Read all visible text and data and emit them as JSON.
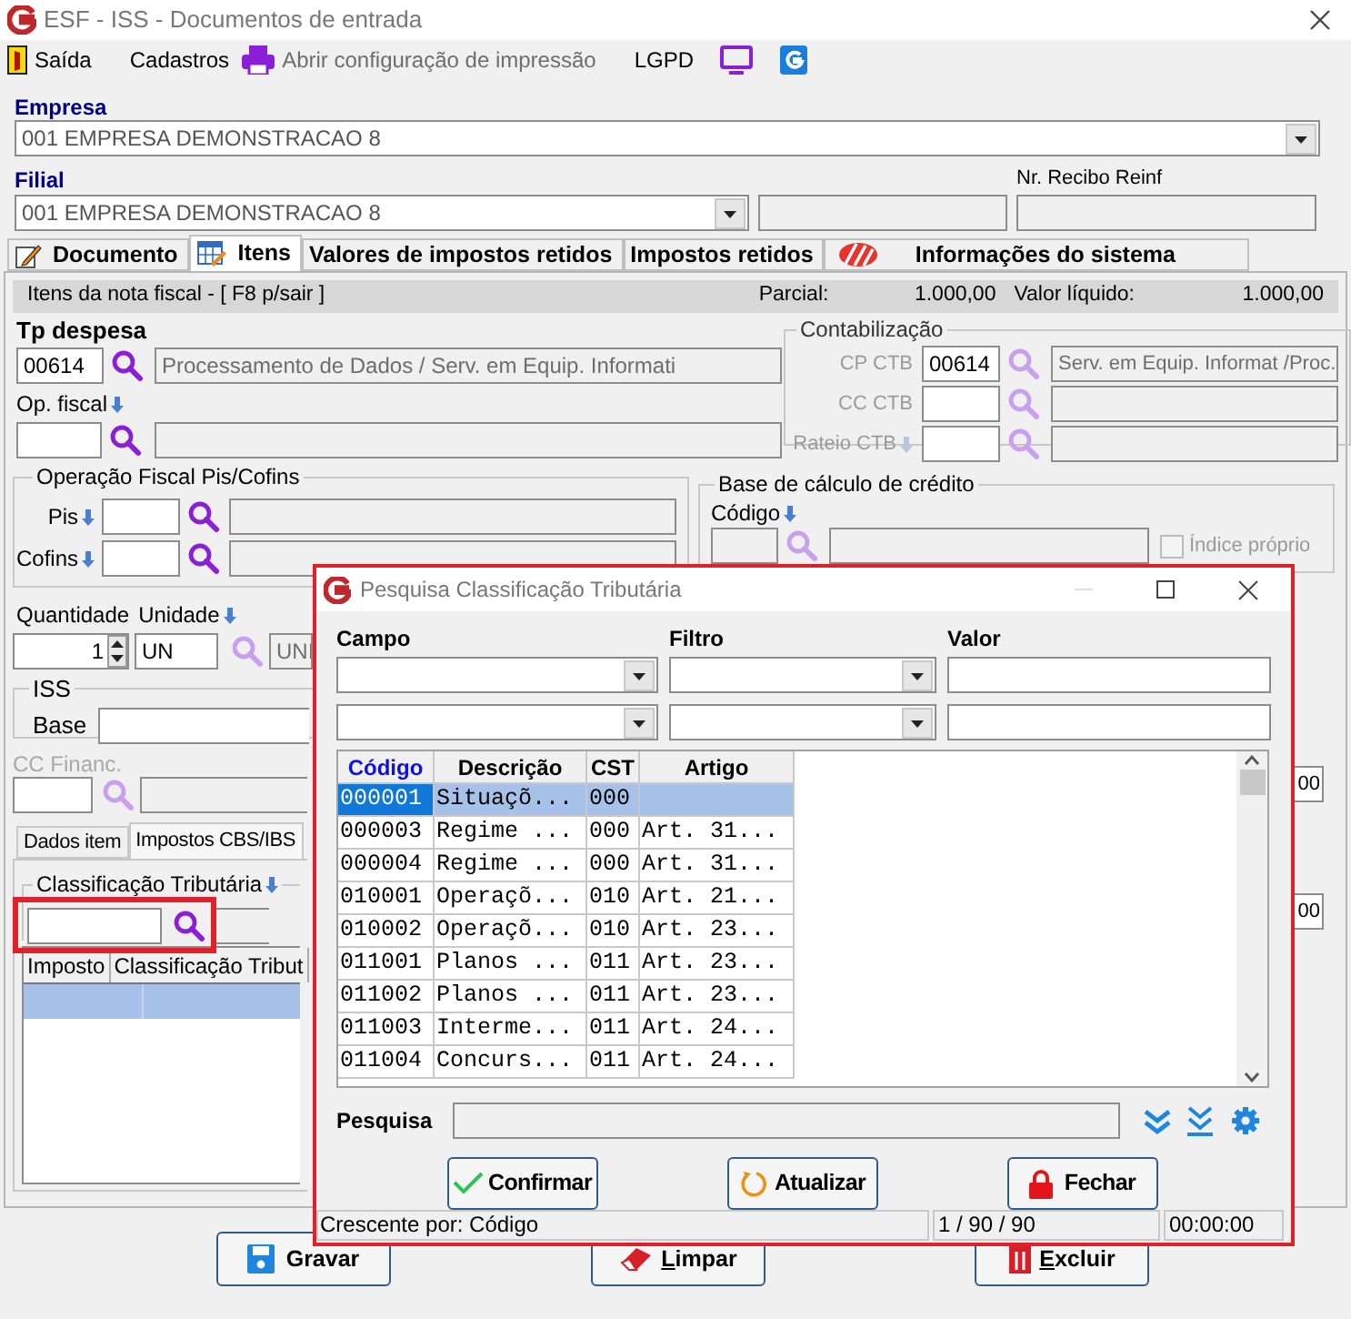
{
  "window": {
    "title": "ESF - ISS - Documentos de entrada"
  },
  "menu": [
    {
      "kind": "exit",
      "label": "Saída",
      "disabled": false
    },
    {
      "kind": "plain",
      "label": "Cadastros",
      "disabled": false
    },
    {
      "kind": "print",
      "label": "Abrir configuração de impressão",
      "disabled": true
    },
    {
      "kind": "plain",
      "label": "LGPD",
      "disabled": false
    },
    {
      "kind": "monitor",
      "disabled": false
    },
    {
      "kind": "logo",
      "disabled": false
    }
  ],
  "empresa": {
    "label": "Empresa",
    "value": "001 EMPRESA DEMONSTRACAO 8"
  },
  "filial": {
    "label": "Filial",
    "value": "001 EMPRESA DEMONSTRACAO 8"
  },
  "recibo_reinf": {
    "label": "Nr. Recibo Reinf"
  },
  "tabs": [
    {
      "label": "Documento",
      "kind": "document",
      "selected": false
    },
    {
      "label": "Itens",
      "kind": "grid",
      "selected": true
    },
    {
      "label": "Valores de impostos retidos",
      "kind": "plain",
      "selected": false
    },
    {
      "label": "Impostos retidos",
      "kind": "plain",
      "selected": false
    },
    {
      "label": "Informações do sistema",
      "kind": "logo",
      "selected": false
    }
  ],
  "items_header": {
    "title": "Itens da nota fiscal - [ F8 p/sair ]",
    "parcial_label": "Parcial:",
    "parcial": "1.000,00",
    "liquido_label": "Valor líquido:",
    "liquido": "1.000,00"
  },
  "tp_despesa": {
    "label": "Tp despesa",
    "code": "00614",
    "description": "Processamento de Dados / Serv. em Equip. Informati"
  },
  "op_fiscal": {
    "label": "Op. fiscal"
  },
  "contabilizacao": {
    "title": "Contabilização",
    "rows": [
      {
        "label": "CP CTB",
        "code": "00614",
        "description": "Serv. em Equip. Informat /Proc.",
        "arrow": false
      },
      {
        "label": "CC CTB",
        "arrow": false
      },
      {
        "label": "Rateio CTB",
        "arrow": true
      }
    ]
  },
  "pis_cofins": {
    "title": "Operação Fiscal Pis/Cofins",
    "rows": [
      {
        "label": "Pis"
      },
      {
        "label": "Cofins"
      }
    ]
  },
  "base_credito": {
    "title": "Base de cálculo de crédito",
    "codigo_label": "Código",
    "indice": {
      "label": "Índice próprio",
      "checked": false,
      "disabled": true
    }
  },
  "quantidade": {
    "label": "Quantidade",
    "value": "1"
  },
  "unidade": {
    "label": "Unidade",
    "code": "UN",
    "description": "UNI"
  },
  "iss": {
    "title": "ISS",
    "base_label": "Base"
  },
  "cc_financ": {
    "label": "CC Financ.",
    "disabled": true
  },
  "right_fragments": [
    "00",
    "00"
  ],
  "subtabs": [
    {
      "label": "Dados item",
      "selected": false
    },
    {
      "label": "Impostos CBS/IBS",
      "selected": true
    }
  ],
  "classificacao": {
    "title": "Classificação Tributária",
    "highlighted": true
  },
  "tax_grid": {
    "columns": [
      "Imposto",
      "Classificação Tribut"
    ]
  },
  "buttons": [
    {
      "kind": "save",
      "label": "Gravar",
      "underline_first": false
    },
    {
      "kind": "clear",
      "label": "Limpar",
      "underline_first": true
    },
    {
      "kind": "delete",
      "label": "Excluir",
      "underline_first": true
    }
  ],
  "dialog": {
    "title": "Pesquisa Classificação Tributária",
    "highlighted": true,
    "filter_labels": [
      "Campo",
      "Filtro",
      "Valor"
    ],
    "columns": [
      {
        "label": "Código",
        "sorted": true
      },
      {
        "label": "Descrição",
        "sorted": false
      },
      {
        "label": "CST",
        "sorted": false
      },
      {
        "label": "Artigo",
        "sorted": false
      }
    ],
    "rows": [
      {
        "codigo": "000001",
        "descricao": "Situaçõ...",
        "cst": "000",
        "selected": true
      },
      {
        "codigo": "000003",
        "descricao": "Regime ...",
        "cst": "000",
        "artigo": "Art. 31...",
        "selected": false
      },
      {
        "codigo": "000004",
        "descricao": "Regime ...",
        "cst": "000",
        "artigo": "Art. 31...",
        "selected": false
      },
      {
        "codigo": "010001",
        "descricao": "Operaçõ...",
        "cst": "010",
        "artigo": "Art. 21...",
        "selected": false
      },
      {
        "codigo": "010002",
        "descricao": "Operaçõ...",
        "cst": "010",
        "artigo": "Art. 23...",
        "selected": false
      },
      {
        "codigo": "011001",
        "descricao": "Planos ...",
        "cst": "011",
        "artigo": "Art. 23...",
        "selected": false
      },
      {
        "codigo": "011002",
        "descricao": "Planos ...",
        "cst": "011",
        "artigo": "Art. 23...",
        "selected": false
      },
      {
        "codigo": "011003",
        "descricao": "Interme...",
        "cst": "011",
        "artigo": "Art. 24...",
        "selected": false
      },
      {
        "codigo": "011004",
        "descricao": "Concurs...",
        "cst": "011",
        "artigo": "Art. 24...",
        "selected": false
      }
    ],
    "search_label": "Pesquisa",
    "buttons": [
      {
        "kind": "confirm",
        "label": "Confirmar"
      },
      {
        "kind": "refresh",
        "label": "Atualizar"
      },
      {
        "kind": "lock",
        "label": "Fechar"
      }
    ],
    "status": [
      "Crescente por: Código",
      "1 / 90 / 90",
      "00:00:00"
    ]
  }
}
